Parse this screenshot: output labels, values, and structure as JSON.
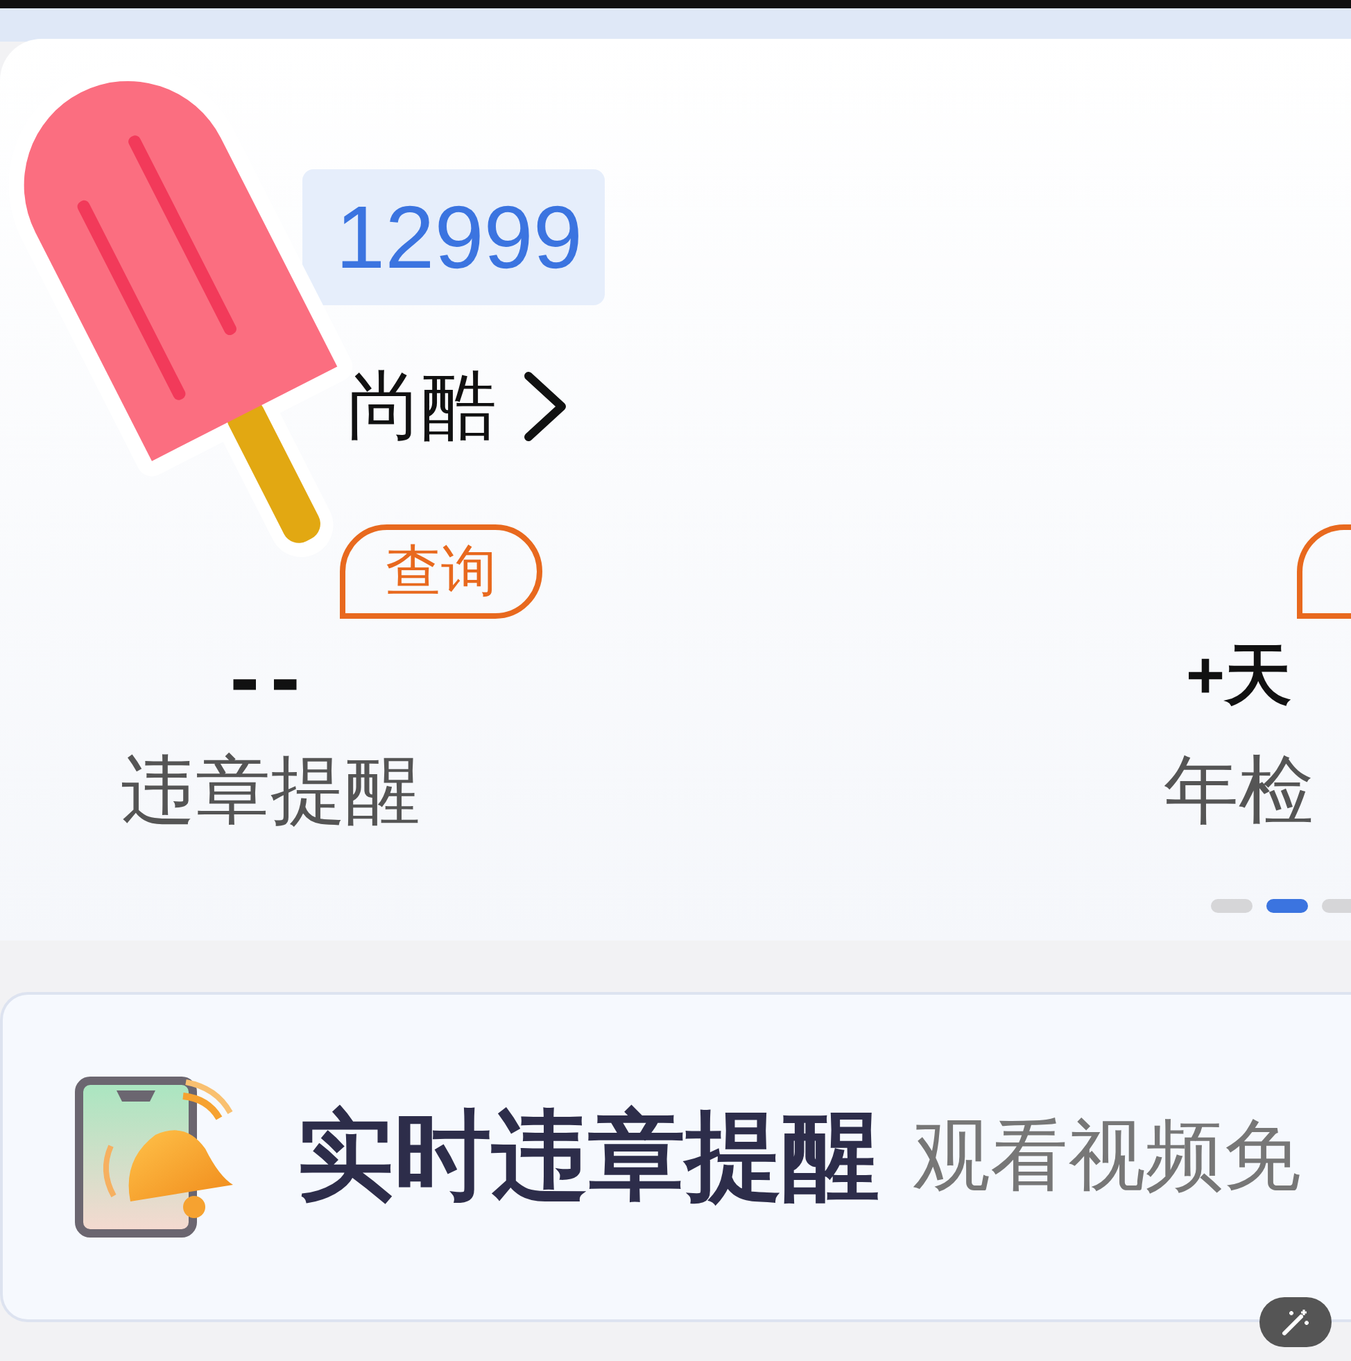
{
  "header": {
    "plate": "12999",
    "car_name": "尚酷"
  },
  "stats": [
    {
      "has_badge": true,
      "badge": "查询",
      "value": "--",
      "label": "违章提醒"
    },
    {
      "has_badge": true,
      "value": "+天",
      "label": "年检"
    }
  ],
  "pager": [
    {
      "selected": false
    },
    {
      "selected": true
    },
    {
      "selected": false
    }
  ],
  "promo": {
    "title": "实时违章提醒",
    "subtitle": "观看视频免"
  },
  "sticker": {
    "kind": "popsicle"
  }
}
